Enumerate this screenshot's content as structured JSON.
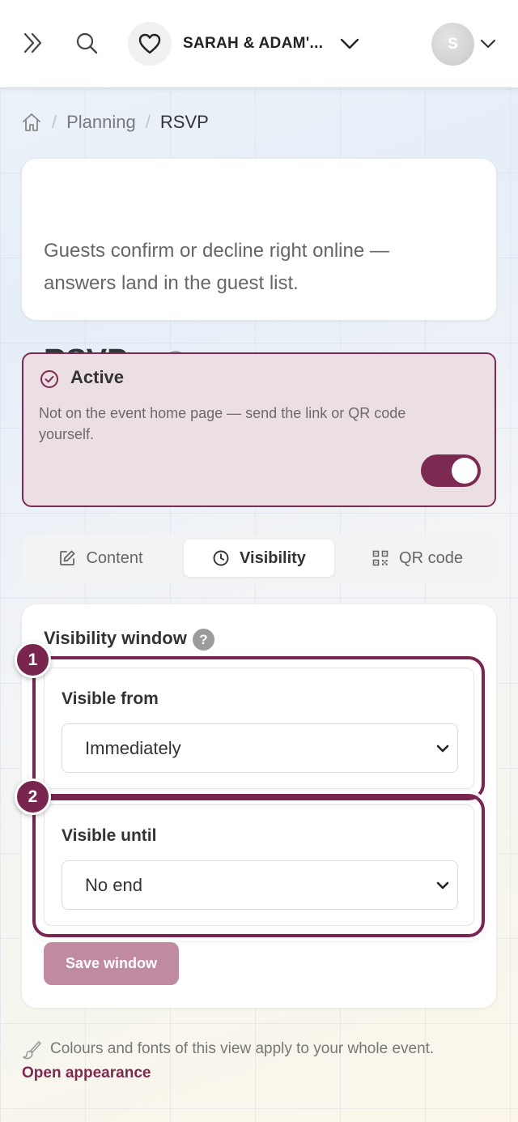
{
  "topbar": {
    "event_name": "SARAH & ADAM'...",
    "avatar_initial": "S",
    "icons": [
      "expand-sidebar-icon",
      "search-icon",
      "heart-icon",
      "chevron-down-icon"
    ]
  },
  "breadcrumb": {
    "items": [
      "Planning",
      "RSVP"
    ]
  },
  "intro": {
    "title": "RSVP",
    "description": "Guests confirm or decline right online — answers land in the guest list."
  },
  "status": {
    "label": "Active",
    "note": "Not on the event home page — send the link or QR code yourself.",
    "toggle_on": true
  },
  "tabs": [
    {
      "label": "Content",
      "icon": "edit-icon",
      "active": false
    },
    {
      "label": "Visibility",
      "icon": "clock-icon",
      "active": true
    },
    {
      "label": "QR code",
      "icon": "qr-code-icon",
      "active": false
    }
  ],
  "visibility": {
    "title": "Visibility window",
    "help": "?",
    "from": {
      "label": "Visible from",
      "value": "Immediately"
    },
    "until": {
      "label": "Visible until",
      "value": "No end"
    },
    "save_label": "Save window"
  },
  "callouts": [
    "1",
    "2"
  ],
  "footer": {
    "note": "Colours and fonts of this view apply to your whole event.",
    "link": "Open appearance"
  },
  "colors": {
    "accent": "#7d2a52",
    "active_bg": "#ecdfe3",
    "save_disabled": "#c08aa1"
  }
}
